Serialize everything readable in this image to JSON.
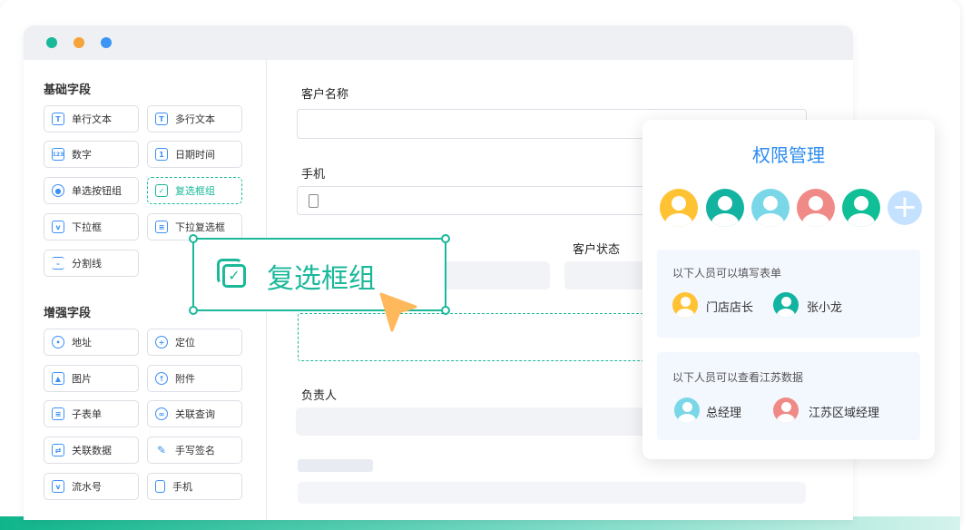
{
  "window": {
    "dots": [
      "#18b89a",
      "#f7a33b",
      "#3b95f5"
    ]
  },
  "sidebar": {
    "basic_title": "基础字段",
    "basic": [
      "单行文本",
      "多行文本",
      "数字",
      "日期时间",
      "单选按钮组",
      "复选框组",
      "下拉框",
      "下拉复选框",
      "分割线"
    ],
    "enhanced_title": "增强字段",
    "enhanced": [
      "地址",
      "定位",
      "图片",
      "附件",
      "子表单",
      "关联查询",
      "关联数据",
      "手写签名",
      "流水号",
      "手机"
    ]
  },
  "form": {
    "customer_name": "客户名称",
    "phone": "手机",
    "customer_status": "客户状态",
    "owner": "负责人"
  },
  "drag": {
    "label": "复选框组"
  },
  "permission": {
    "title": "权限管理",
    "avatar_colors": [
      "#ffc233",
      "#12b3a0",
      "#7ad7e8",
      "#f08a86",
      "#10bf96"
    ],
    "fill_section": {
      "title": "以下人员可以填写表单",
      "people": [
        {
          "name": "门店店长",
          "color": "#ffc233"
        },
        {
          "name": "张小龙",
          "color": "#12b3a0"
        }
      ]
    },
    "view_section": {
      "title": "以下人员可以查看江苏数据",
      "people": [
        {
          "name": "总经理",
          "color": "#7ad7e8"
        },
        {
          "name": "江苏区域经理",
          "color": "#f08a86"
        }
      ]
    }
  },
  "colors": {
    "accent": "#1bb89a",
    "blue": "#2d8cf0",
    "cursor": "#ffb85c"
  }
}
